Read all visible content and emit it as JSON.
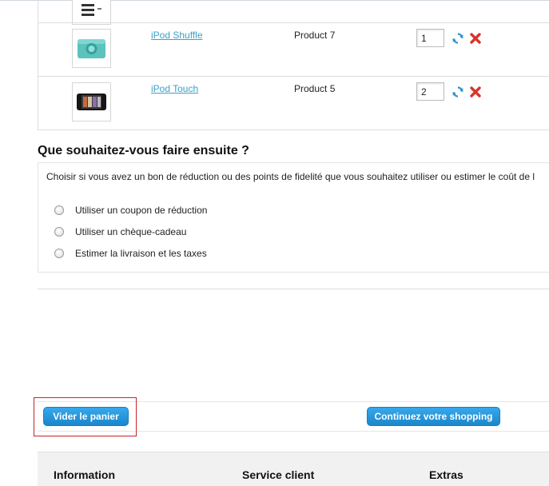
{
  "cart": {
    "rows": [
      {
        "name": "",
        "model": "",
        "quantity": ""
      },
      {
        "name": "iPod Shuffle",
        "model": "Product 7",
        "quantity": "1"
      },
      {
        "name": "iPod Touch",
        "model": "Product 5",
        "quantity": "2"
      }
    ],
    "icons": [
      "update-icon",
      "remove-icon"
    ],
    "colors": {
      "link": "#3aa0c8",
      "update": "#2a8fd0",
      "remove": "#d9332b"
    }
  },
  "next_step": {
    "title": "Que souhaitez-vous faire ensuite ?",
    "intro": "Choisir si vous avez un bon de réduction ou des points de fidelité que vous souhaitez utiliser ou estimer le coût de l",
    "options": [
      "Utiliser un coupon de réduction",
      "Utiliser un chèque-cadeau",
      "Estimer la livraison et les taxes"
    ]
  },
  "buttons": {
    "clear_cart": "Vider le panier",
    "continue_shopping": "Continuez votre shopping",
    "color": "#2196df",
    "highlight_color": "#c8232c"
  },
  "footer": {
    "columns": [
      "Information",
      "Service client",
      "Extras"
    ]
  }
}
